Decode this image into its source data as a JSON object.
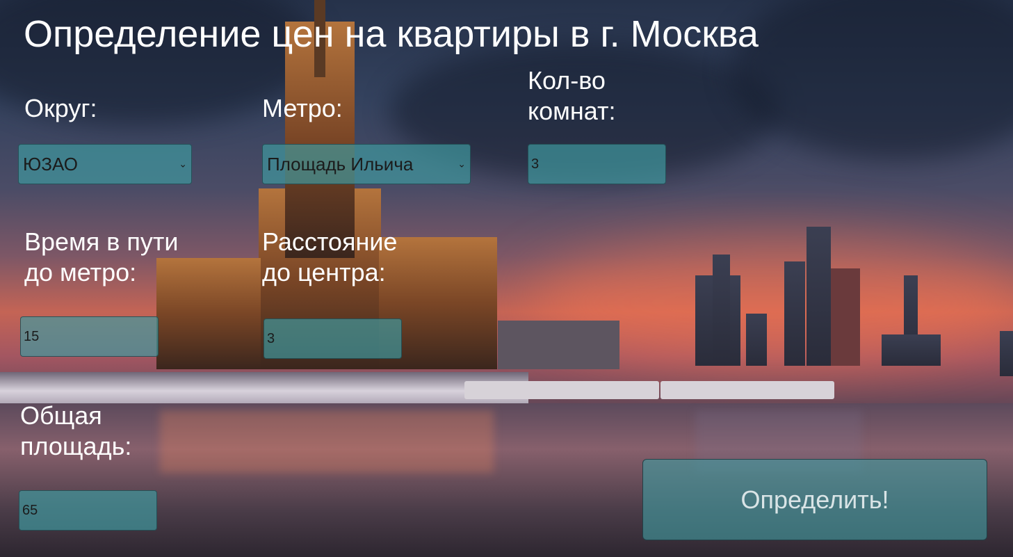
{
  "page": {
    "title": "Определение цен на квартиры в г. Москва"
  },
  "form": {
    "district": {
      "label": "Округ:",
      "selected": "ЮЗАО"
    },
    "metro": {
      "label": "Метро:",
      "selected": "Площадь Ильича"
    },
    "rooms": {
      "label_line1": "Кол-во",
      "label_line2": "комнат:",
      "value": "3"
    },
    "time_to_metro": {
      "label_line1": "Время в пути",
      "label_line2": "до метро:",
      "value": "15"
    },
    "distance_to_center": {
      "label_line1": "Расстояние",
      "label_line2": "до центра:",
      "value": "3"
    },
    "total_area": {
      "label_line1": "Общая",
      "label_line2": "площадь:",
      "value": "65"
    },
    "submit_label": "Определить!"
  },
  "icons": {
    "select_chevron": "chevron-down-icon"
  },
  "colors": {
    "field_bg": "#409ba0",
    "text": "#ffffff"
  }
}
